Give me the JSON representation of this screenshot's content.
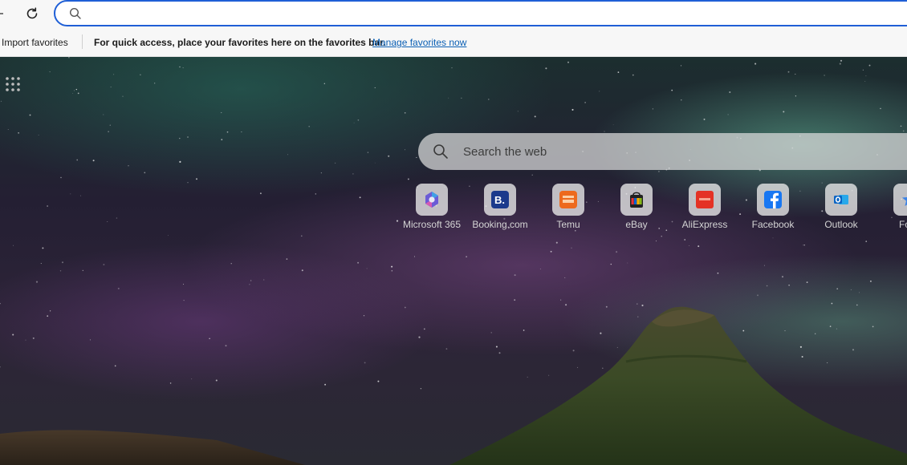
{
  "toolbar": {
    "address_value": "",
    "address_placeholder": ""
  },
  "favorites_bar": {
    "import_label": "Import favorites",
    "message": "For quick access, place your favorites here on the favorites bar.",
    "manage_link": "Manage favorites now"
  },
  "new_tab": {
    "search_placeholder": "Search the web",
    "quick_links": [
      {
        "label": "Microsoft 365",
        "icon": "microsoft-365-icon"
      },
      {
        "label": "Booking.com",
        "icon": "booking-icon"
      },
      {
        "label": "Temu",
        "icon": "temu-icon"
      },
      {
        "label": "eBay",
        "icon": "ebay-icon"
      },
      {
        "label": "AliExpress",
        "icon": "aliexpress-icon"
      },
      {
        "label": "Facebook",
        "icon": "facebook-icon"
      },
      {
        "label": "Outlook",
        "icon": "outlook-icon"
      },
      {
        "label": "Follo",
        "icon": "follow-icon"
      }
    ]
  },
  "colors": {
    "address_border": "#1f5fd6",
    "link": "#0a5fb4"
  }
}
